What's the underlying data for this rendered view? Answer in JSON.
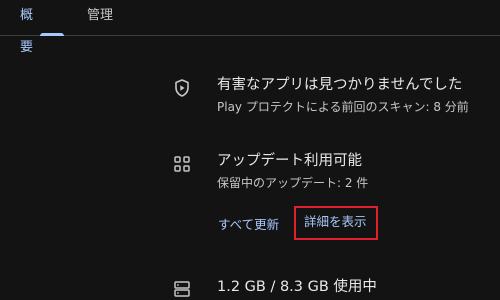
{
  "tabs": [
    {
      "label": "概要",
      "active": true
    },
    {
      "label": "管理",
      "active": false
    }
  ],
  "protect": {
    "icon": "shield-play-icon",
    "title": "有害なアプリは見つかりませんでした",
    "subtitle": "Play プロテクトによる前回のスキャン: 8 分前"
  },
  "updates": {
    "icon": "apps-grid-icon",
    "title": "アップデート利用可能",
    "subtitle": "保留中のアップデート: 2 件",
    "update_all_label": "すべて更新",
    "details_label": "詳細を表示"
  },
  "storage": {
    "icon": "storage-icon",
    "title": "1.2 GB / 8.3 GB 使用中"
  },
  "colors": {
    "background": "#131313",
    "accent": "#a8c7fa",
    "highlight_box": "#e0202f"
  }
}
